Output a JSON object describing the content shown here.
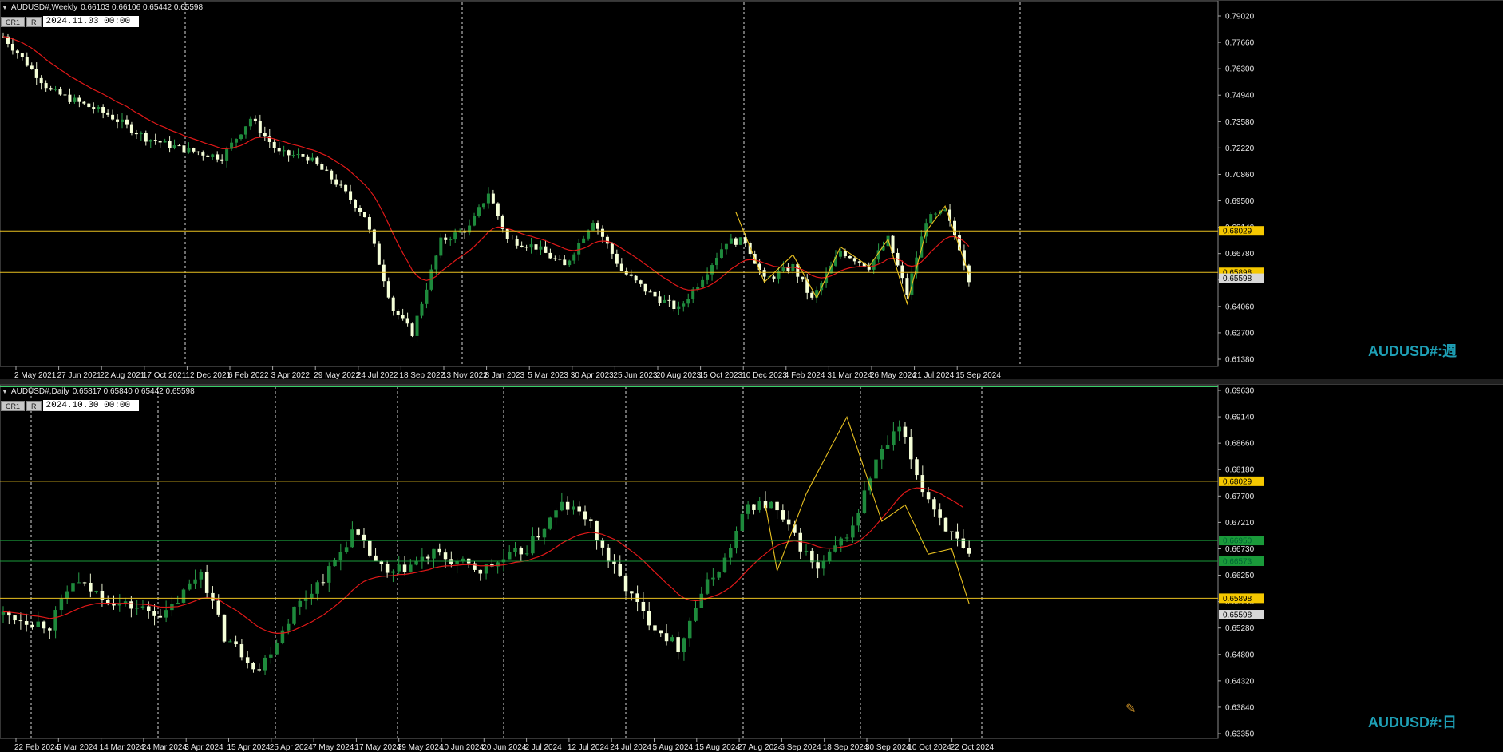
{
  "colors": {
    "background": "#000000",
    "bull_candle": "#1e8a3c",
    "bear_candle": "#f5ffd8",
    "ma_line": "#e01818",
    "zigzag": "#e8c020",
    "support_resistance": "#e8c020",
    "green_zone": "#1a9a3a",
    "grid": "#ffffff",
    "watermark": "#1e9fb5"
  },
  "weekly": {
    "symbol_header": "AUDUSD#,Weekly",
    "ohlc_header": "0.66103 0.66106 0.65442 0.65598",
    "badge_cr": "CR1",
    "badge_r": "R",
    "cursor_date": "2024.11.03 00:00",
    "watermark": "AUDUSD#:週",
    "hlines": [
      {
        "price": 0.68029,
        "label": "0.68029"
      },
      {
        "price": 0.65898,
        "label": "0.65898"
      }
    ],
    "current_price": "0.65598",
    "price_ticks": [
      "0.79020",
      "0.77660",
      "0.76300",
      "0.74940",
      "0.73580",
      "0.72220",
      "0.70860",
      "0.69500",
      "0.68140",
      "0.66780",
      "0.65420",
      "0.64060",
      "0.62700",
      "0.61380"
    ],
    "date_ticks": [
      "2 May 2021",
      "27 Jun 2021",
      "22 Aug 2021",
      "17 Oct 2021",
      "12 Dec 2021",
      "6 Feb 2022",
      "3 Apr 2022",
      "29 May 2022",
      "24 Jul 2022",
      "18 Sep 2022",
      "13 Nov 2022",
      "8 Jan 2023",
      "5 Mar 2023",
      "30 Apr 2023",
      "25 Jun 2023",
      "20 Aug 2023",
      "15 Oct 2023",
      "10 Dec 2023",
      "4 Feb 2024",
      "31 Mar 2024",
      "26 May 2024",
      "21 Jul 2024",
      "15 Sep 2024"
    ],
    "price_range": [
      0.612,
      0.795
    ]
  },
  "daily": {
    "symbol_header": "AUDUSD#,Daily",
    "ohlc_header": "0.65817 0.65840 0.65442 0.65598",
    "badge_cr": "CR1",
    "badge_r": "R",
    "cursor_date": "2024.10.30 00:00",
    "watermark": "AUDUSD#:日",
    "hlines": [
      {
        "price": 0.68029,
        "label": "0.68029"
      },
      {
        "price": 0.65898,
        "label": "0.65898"
      }
    ],
    "green_lines": [
      {
        "price": 0.6695,
        "label": "0.66950"
      },
      {
        "price": 0.66573,
        "label": "0.66573"
      }
    ],
    "current_price": "0.65598",
    "price_ticks": [
      "0.69630",
      "0.69140",
      "0.68660",
      "0.68180",
      "0.67700",
      "0.67210",
      "0.66730",
      "0.66250",
      "0.65770",
      "0.65280",
      "0.64800",
      "0.64320",
      "0.63840",
      "0.63350"
    ],
    "date_ticks": [
      "22 Feb 2024",
      "5 Mar 2024",
      "14 Mar 2024",
      "24 Mar 2024",
      "3 Apr 2024",
      "15 Apr 2024",
      "25 Apr 2024",
      "7 May 2024",
      "17 May 2024",
      "29 May 2024",
      "10 Jun 2024",
      "20 Jun 2024",
      "2 Jul 2024",
      "12 Jul 2024",
      "24 Jul 2024",
      "5 Aug 2024",
      "15 Aug 2024",
      "27 Aug 2024",
      "6 Sep 2024",
      "18 Sep 2024",
      "30 Sep 2024",
      "10 Oct 2024",
      "22 Oct 2024"
    ],
    "price_range": [
      0.633,
      0.697
    ]
  }
}
